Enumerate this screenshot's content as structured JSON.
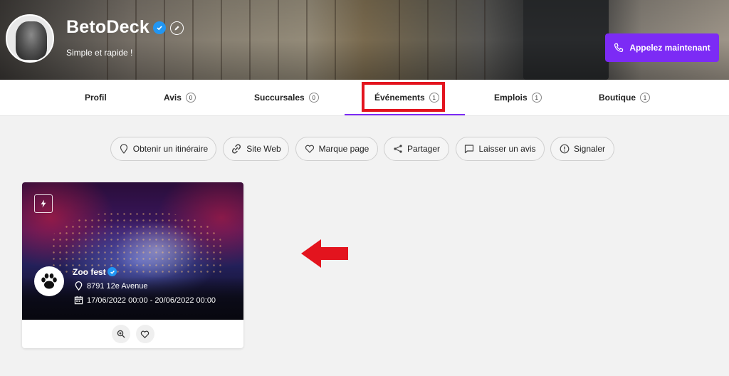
{
  "header": {
    "name": "BetoDeck",
    "tagline": "Simple et rapide !",
    "call_button": "Appelez maintenant"
  },
  "tabs": [
    {
      "label": "Profil",
      "count": null
    },
    {
      "label": "Avis",
      "count": "0"
    },
    {
      "label": "Succursales",
      "count": "0"
    },
    {
      "label": "Événements",
      "count": "1",
      "active": true
    },
    {
      "label": "Emplois",
      "count": "1"
    },
    {
      "label": "Boutique",
      "count": "1"
    }
  ],
  "actions": [
    {
      "label": "Obtenir un itinéraire",
      "icon": "location-pin-icon"
    },
    {
      "label": "Site Web",
      "icon": "link-icon"
    },
    {
      "label": "Marque page",
      "icon": "heart-icon"
    },
    {
      "label": "Partager",
      "icon": "share-icon"
    },
    {
      "label": "Laisser un avis",
      "icon": "comment-icon"
    },
    {
      "label": "Signaler",
      "icon": "alert-icon"
    }
  ],
  "event_card": {
    "title": "Zoo fest",
    "address": "8791 12e Avenue",
    "dates": "17/06/2022 00:00 - 20/06/2022 00:00"
  },
  "colors": {
    "accent": "#7c2bf5",
    "highlight": "#e3141e",
    "verified": "#2196f3"
  }
}
